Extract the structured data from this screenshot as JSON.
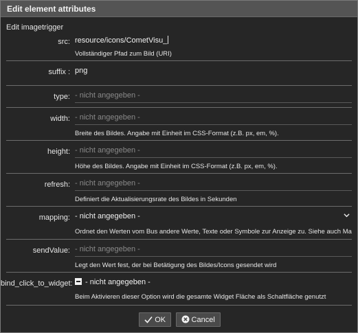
{
  "dialog": {
    "title": "Edit element attributes",
    "subtitle": "Edit imagetrigger"
  },
  "fields": {
    "src": {
      "label": "src:",
      "value": "resource/icons/CometVisu_",
      "desc": "Vollständiger Pfad zum Bild (URI)"
    },
    "suffix": {
      "label": "suffix :",
      "value": "png"
    },
    "type": {
      "label": "type:",
      "placeholder": "- nicht angegeben -"
    },
    "width": {
      "label": "width:",
      "placeholder": "- nicht angegeben -",
      "desc": "Breite des Bildes. Angabe mit Einheit im CSS-Format (z.B. px, em, %)."
    },
    "height": {
      "label": "height:",
      "placeholder": "- nicht angegeben -",
      "desc": "Höhe des Bildes. Angabe mit Einheit im CSS-Format (z.B. px, em, %)."
    },
    "refresh": {
      "label": "refresh:",
      "placeholder": "- nicht angegeben -",
      "desc": "Definiert die Aktualisierungsrate des Bildes in Sekunden"
    },
    "mapping": {
      "label": "mapping:",
      "value": "- nicht angegeben -",
      "desc": "Ordnet den Werten vom Bus andere Werte, Texte oder Symbole zur Anzeige zu. Siehe auch Mapping"
    },
    "sendValue": {
      "label": "sendValue:",
      "placeholder": "- nicht angegeben -",
      "desc": "Legt den Wert fest, der bei Betätigung des Bildes/Icons gesendet wird"
    },
    "bind_click_to_widget": {
      "label": "bind_click_to_widget:",
      "value": "- nicht angegeben -",
      "desc": "Beim Aktivieren dieser Option wird die gesamte Widget Fläche als Schaltfläche genutzt"
    }
  },
  "buttons": {
    "ok": "OK",
    "cancel": "Cancel"
  },
  "icons": {
    "mapping_dropdown": "chevron-down-icon",
    "ok": "check-icon",
    "cancel": "close-circle-icon",
    "bind_checkbox": "indeterminate-checkbox-icon"
  }
}
